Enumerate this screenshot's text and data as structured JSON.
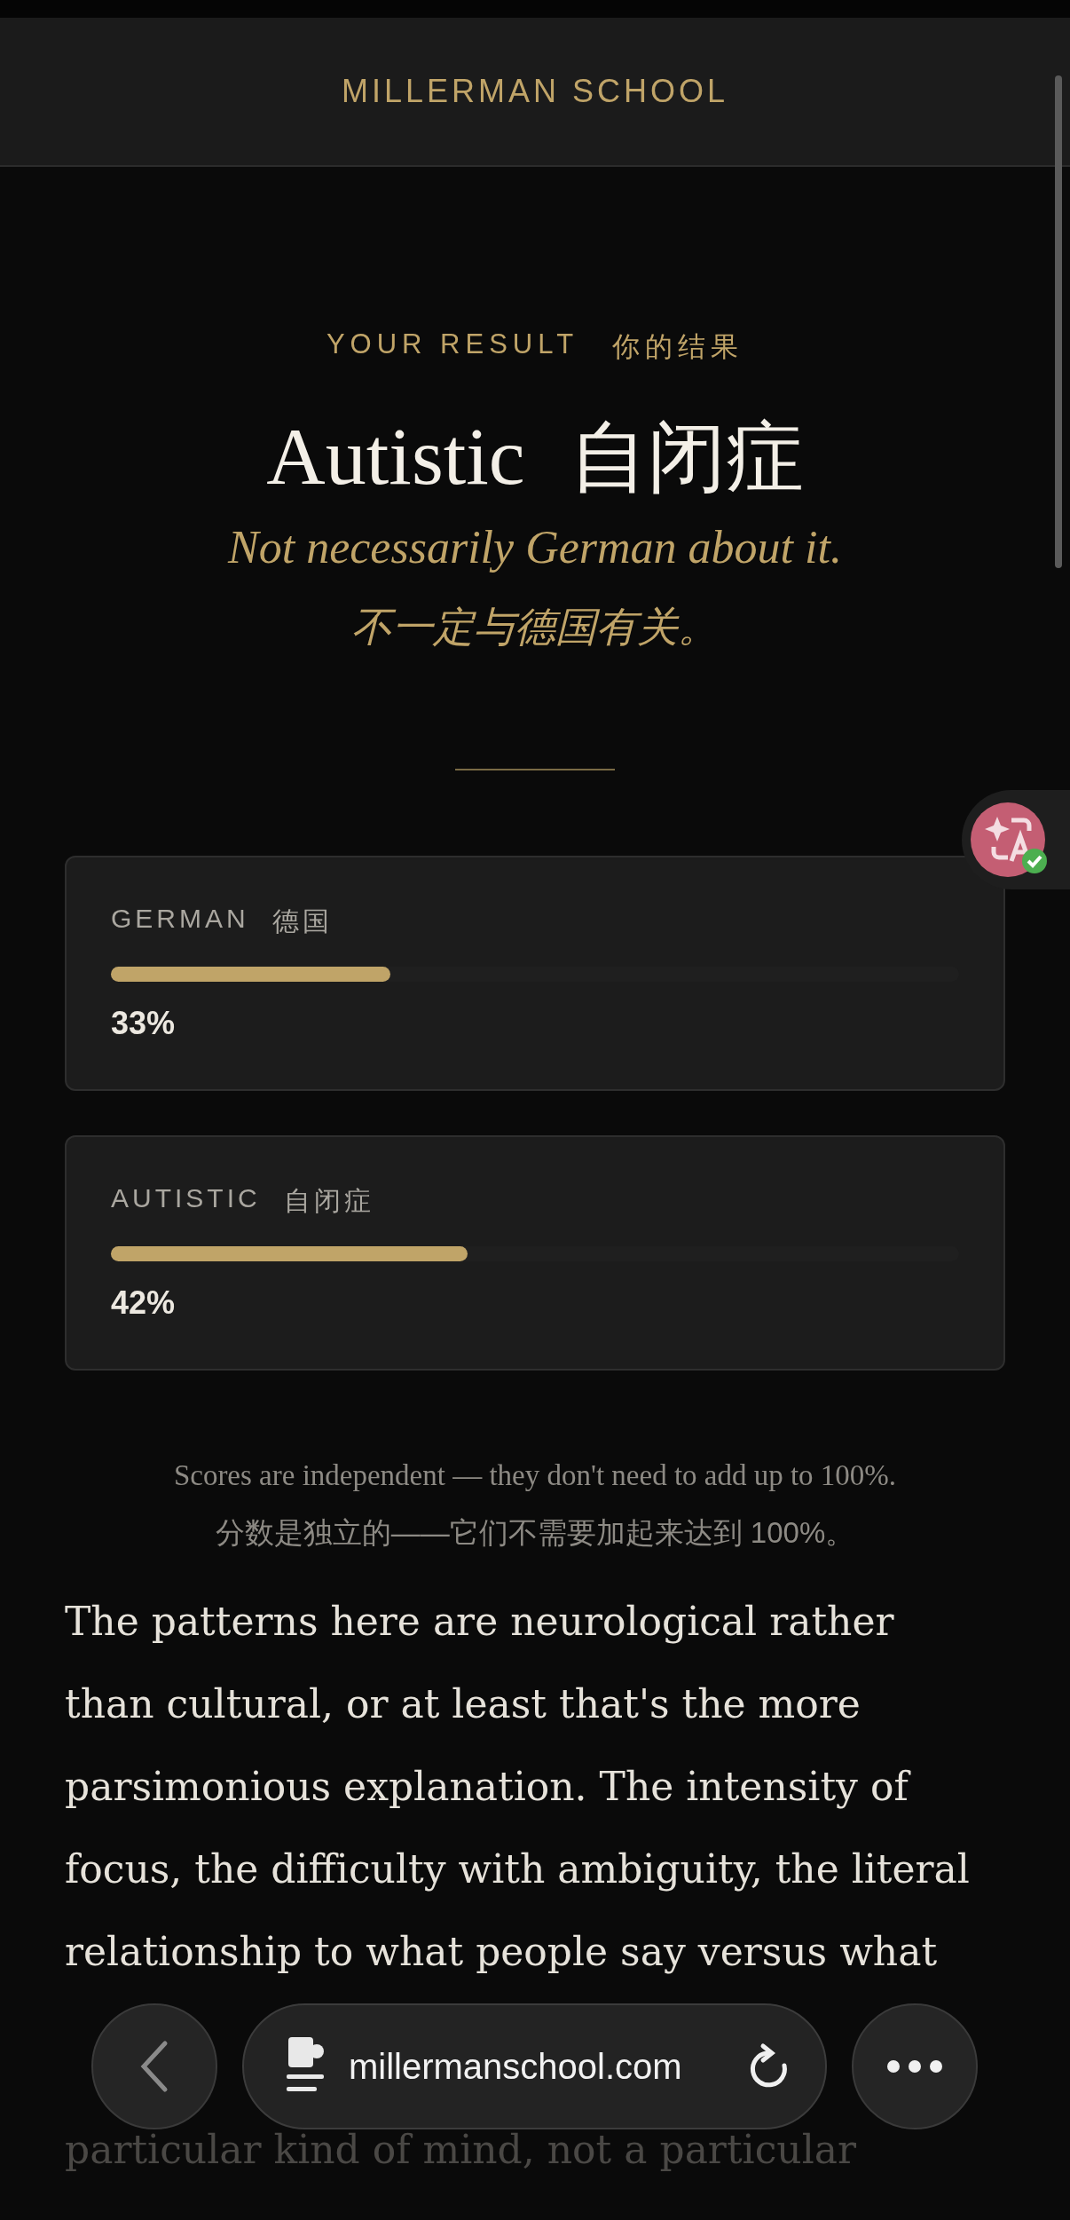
{
  "header": {
    "brand": "MILLERMAN SCHOOL"
  },
  "result": {
    "eyebrow": "YOUR RESULT",
    "eyebrow_zh": "你的结果",
    "title": "Autistic",
    "title_zh": "自闭症",
    "subtitle": "Not necessarily German about it.",
    "subtitle_zh": "不一定与德国有关。"
  },
  "scores": [
    {
      "label": "GERMAN",
      "label_zh": "德国",
      "level": 0.33,
      "reading": "33%"
    },
    {
      "label": "AUTISTIC",
      "label_zh": "自闭症",
      "level": 0.42,
      "reading": "42%"
    }
  ],
  "note": "Scores are independent — they don't need to add up to 100%.",
  "note_zh": "分数是独立的——它们不需要加起来达到 100%。",
  "body": {
    "paragraph": "The patterns here are neurological rather than cultural, or at least that's the more parsimonious explanation. The intensity of focus, the difficulty with ambiguity, the literal relationship to what people say versus what",
    "faded_lines": [
      "particular kind of mind, not a particular"
    ]
  },
  "browser_bar": {
    "url": "millermanschool.com"
  }
}
